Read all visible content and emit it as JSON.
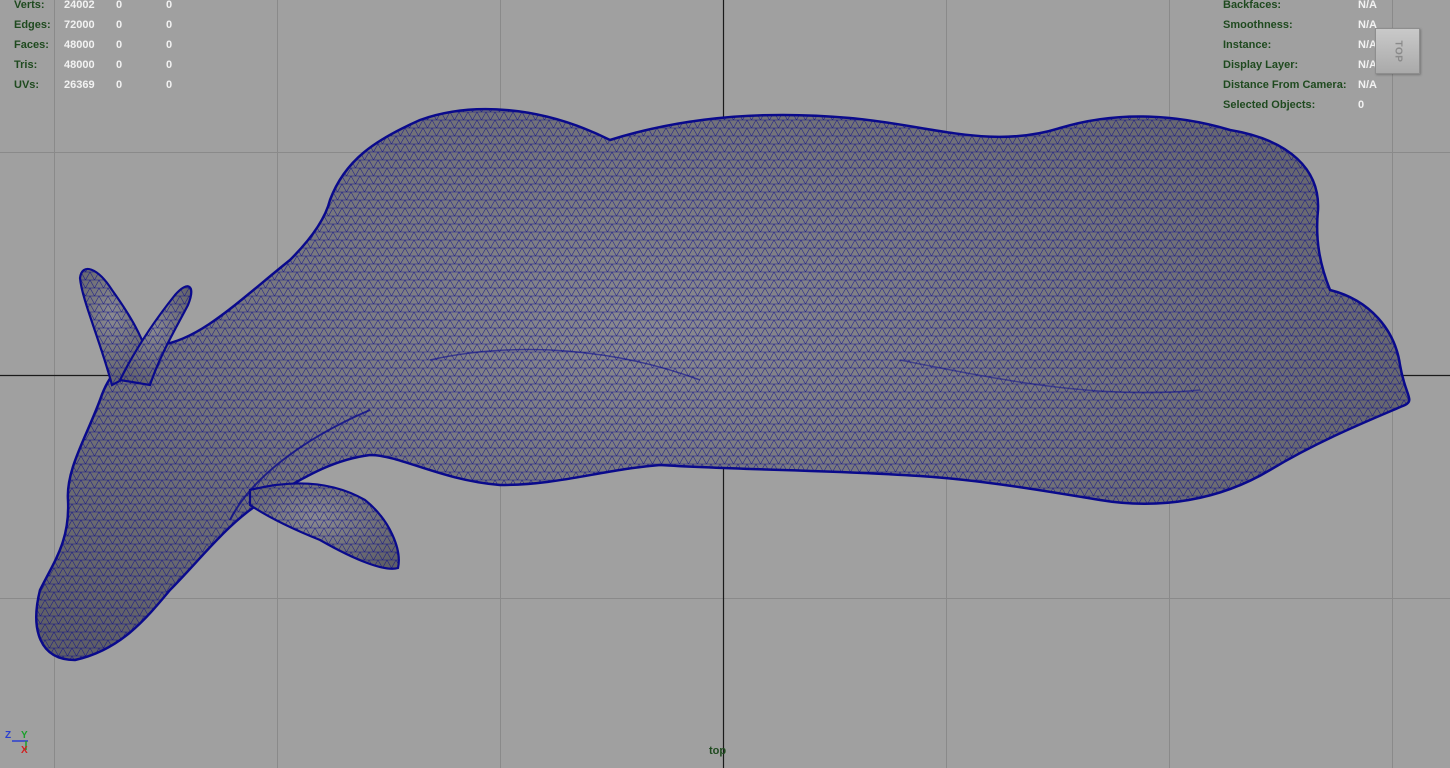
{
  "hud_left": {
    "rows": [
      {
        "label": "Verts:",
        "v1": "24002",
        "v2": "0",
        "v3": "0"
      },
      {
        "label": "Edges:",
        "v1": "72000",
        "v2": "0",
        "v3": "0"
      },
      {
        "label": "Faces:",
        "v1": "48000",
        "v2": "0",
        "v3": "0"
      },
      {
        "label": "Tris:",
        "v1": "48000",
        "v2": "0",
        "v3": "0"
      },
      {
        "label": "UVs:",
        "v1": "26369",
        "v2": "0",
        "v3": "0"
      }
    ]
  },
  "hud_right": {
    "rows": [
      {
        "label": "Backfaces:",
        "value": "N/A"
      },
      {
        "label": "Smoothness:",
        "value": "N/A"
      },
      {
        "label": "Instance:",
        "value": "N/A"
      },
      {
        "label": "Display Layer:",
        "value": "N/A"
      },
      {
        "label": "Distance From Camera:",
        "value": "N/A"
      },
      {
        "label": "Selected Objects:",
        "value": "0"
      }
    ]
  },
  "viewcube": {
    "label": "TOP"
  },
  "camera": {
    "name": "top"
  },
  "axis": {
    "z": "Z",
    "y": "Y",
    "x": "X"
  },
  "colors": {
    "background": "#a0a0a0",
    "grid": "#8a8a8a",
    "grid_axis": "#1a1a1a",
    "wireframe": "#0a0a8c",
    "mesh_fill": "#6f6f74",
    "hud_label": "#1f4a1f",
    "hud_value": "#f2f2f2"
  }
}
